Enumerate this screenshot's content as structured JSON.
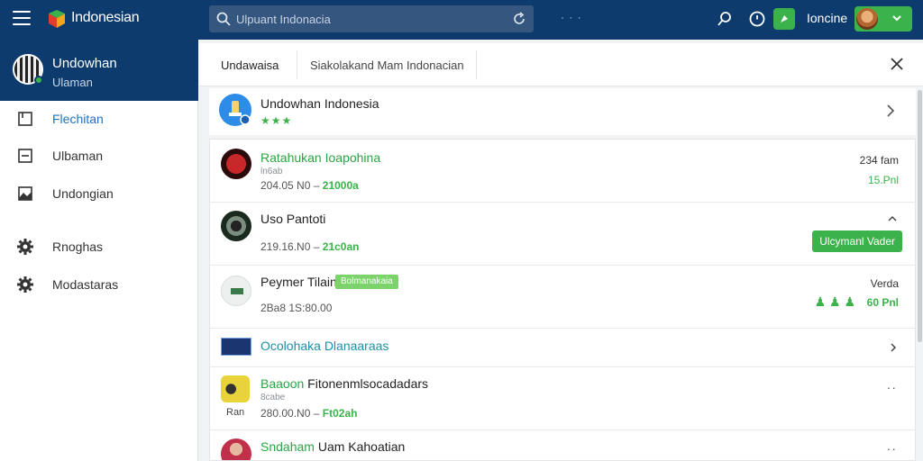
{
  "header": {
    "app_title": "Indonesian",
    "search_placeholder": "Ulpuant Indonacia",
    "more_dots": "· · ·",
    "user_name": "Ioncine"
  },
  "sidebar": {
    "profile": {
      "name": "Undowhan",
      "subtitle": "Ulaman"
    },
    "items": [
      {
        "label": "Flechitan",
        "icon": "bookmark-icon",
        "active": true
      },
      {
        "label": "Ulbaman",
        "icon": "minus-square-icon"
      },
      {
        "label": "Undongian",
        "icon": "image-icon"
      },
      {
        "label": "Rnoghas",
        "icon": "gear-icon"
      },
      {
        "label": "Modastaras",
        "icon": "gear-icon"
      }
    ]
  },
  "tabs": [
    {
      "label": "Undawaisa"
    },
    {
      "label": "Siakolakand Mam Indonacian"
    }
  ],
  "featured": {
    "title": "Undowhan Indonesia",
    "stars": "★★★"
  },
  "rows": [
    {
      "title": "Ratahukan Ioapohina",
      "sub": "ln6ab",
      "date": "204.05 N0",
      "dash": "–",
      "accent": "21000a",
      "right1": "234 fam",
      "right2": "15.Pnl"
    },
    {
      "title": "Uso Pantoti",
      "sub": "",
      "date": "219.16.N0",
      "dash": "–",
      "accent": "21c0an",
      "button": "Ulcymanl Vader"
    },
    {
      "title": "Peymer Tilain",
      "badge": "Bolmanakaia",
      "date": "2Ba8 1S:80.00",
      "right1": "Verda",
      "right2": "60 Pnl",
      "signal": "♟ ♟ ♟"
    },
    {
      "title": "Ocolohaka Dlanaaraas"
    },
    {
      "title": "Baaoon Fitonenmlsocadadars",
      "sub": "8cabe",
      "label": "Ran",
      "date": "280.00.N0",
      "dash": "–",
      "accent": "Ft02ah"
    },
    {
      "title": "Sndaham Uam Kahoatian",
      "sub": ""
    }
  ],
  "colors": {
    "topbar": "#0d3b6e",
    "accent_green": "#3bb34a",
    "link_blue": "#1f6fc6"
  }
}
